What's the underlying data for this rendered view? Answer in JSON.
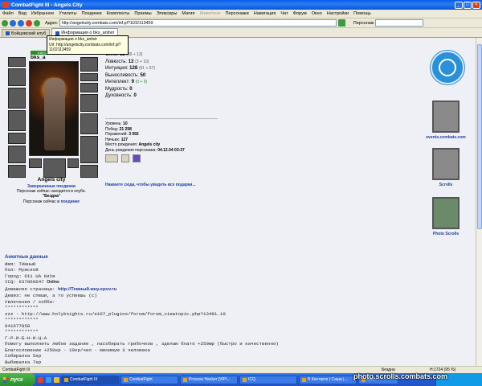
{
  "window": {
    "title": "CombatFight III - Angels City"
  },
  "menu": [
    "Файл",
    "Вид",
    "Избранное",
    "Утилиты",
    "Поединки",
    "Комплекты",
    "Приемы",
    "Эликсиры",
    "Магия",
    "Животное",
    "Персонажи",
    "Навигация",
    "Чат",
    "Форум",
    "Окно",
    "Настройки",
    "Помощь"
  ],
  "toolbar": {
    "address_label": "Адрес",
    "address_value": "http://angelscity.combats.com/inf.pl?1102113459",
    "person_label": "Персонаж"
  },
  "tabs": [
    {
      "label": "Бойцовский клуб"
    },
    {
      "label": "Информация о bks_antivir"
    }
  ],
  "tooltip": {
    "line1": "Информация о bks_antivir",
    "line2": "Url: http://angelscity.combats.com/inf.pl?1102113459"
  },
  "character": {
    "name": "bks_a",
    "hp": "1387/2066",
    "stats": [
      {
        "label": "Сила:",
        "value": "52",
        "extra": "(39 + 13)"
      },
      {
        "label": "Ловкость:",
        "value": "13",
        "extra": "(3 + 10)"
      },
      {
        "label": "Интуиция:",
        "value": "128",
        "extra": "(61 + 67)"
      },
      {
        "label": "Выносливость:",
        "value": "50",
        "extra": ""
      },
      {
        "label": "Интеллект:",
        "value": "9",
        "extra": "(0 + 9)"
      },
      {
        "label": "Мудрость:",
        "value": "0",
        "extra": ""
      },
      {
        "label": "Духовность:",
        "value": "0",
        "extra": ""
      }
    ],
    "info": [
      {
        "label": "Уровень:",
        "value": "10"
      },
      {
        "label": "Побед:",
        "value": "21 298"
      },
      {
        "label": "Поражений:",
        "value": "3 092"
      },
      {
        "label": "Ничьих:",
        "value": "127"
      },
      {
        "label": "Место рождения:",
        "value": "Angels city"
      },
      {
        "label": "День рождения персонажа:",
        "value": "04.12.04 03:37"
      }
    ],
    "gifts_link": "Нажмите сюда, чтобы увидеть все подарки...",
    "city": "Angels city",
    "battles_link": "Завершенные поединки",
    "location_line": "Персонаж сейчас находится в клубе.",
    "location_name": "\"Бездна\"",
    "status_prefix": "Персонаж сейчас",
    "status_link": "в поединке"
  },
  "right_column": {
    "events_label": "events.combats.com",
    "scrolls_label": "Scrolls",
    "photo_label": "Photo Scrolls"
  },
  "profile": {
    "header": "Анкетные данные",
    "lines": [
      "Имя: Тёмный",
      "Пол: Мужской",
      "Город: 011 UA Київ"
    ],
    "icq": "ICQ: 637860647",
    "icq_status": "Online",
    "homepage_label": "Домашняя страница:",
    "homepage_url": "http://Темный.мну.epov.ru",
    "more": [
      "Девиз: не спеши, а то успеешь (с)",
      "Увлечения / хобби:",
      "************",
      "zzz - http://www.holyknights.ru/e107_plugins/forum/forum_viewtopic.php?13491.10",
      "************",
      "841677858",
      "************",
      "Г-Р-И-Б-Н-И-Ц-А",
      "Помогу выполнить любое задание , насобирать грибочков , зделаю блато +250мр (быстро и качественно)",
      "Благословение +250кр - 10кр/чел - минимум 3 человека",
      "Собиралка 5кр",
      "Выбивалка 7кр"
    ]
  },
  "statusbar": {
    "left": "CombatFight III",
    "mid": "Бездна",
    "right": "H:1724 (95 %)"
  },
  "taskbar": {
    "start": "пуск",
    "tasks": [
      "CombatFight III",
      "CombatFight",
      "Process Hacker [VIP\\...",
      "ICQ",
      "В Контакте | Саша |...",
      "Ctrl..."
    ]
  },
  "watermark": "photo.scrolls.combats.com"
}
